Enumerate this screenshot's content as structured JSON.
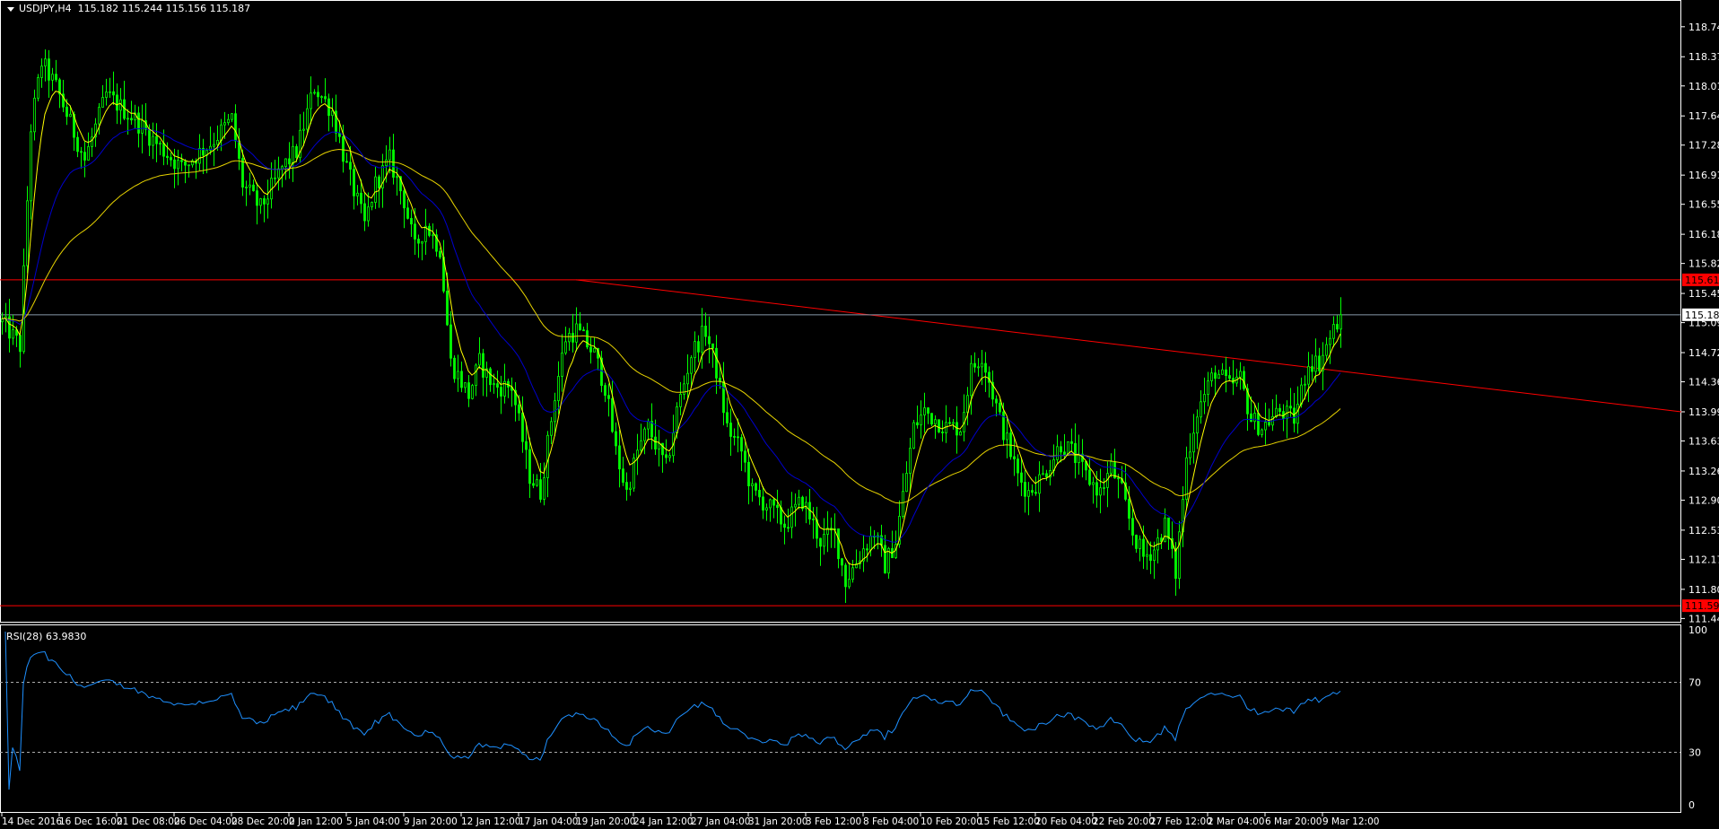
{
  "header": {
    "symbol": "USDJPY,H4",
    "ohlc": "115.182 115.244 115.156 115.187",
    "menu_icon": "triangle-down-icon"
  },
  "rsi_label": "RSI(28) 63.9830",
  "colors": {
    "bull": "#00ff00",
    "bear": "#00ff00",
    "fast_ma": "#ffff00",
    "mid_ma": "#0000cd",
    "slow_ma": "#e6d200",
    "level": "#ff0000",
    "rsi": "#1e90ff",
    "axis": "#ffffff"
  },
  "chart_data": {
    "type": "candlestick",
    "title": "USDJPY,H4",
    "price_ticks": [
      "118.740",
      "118.370",
      "118.010",
      "117.640",
      "117.280",
      "116.910",
      "116.550",
      "116.180",
      "115.820",
      "115.450",
      "115.090",
      "114.720",
      "114.360",
      "113.990",
      "113.630",
      "113.260",
      "112.900",
      "112.530",
      "112.170",
      "111.800",
      "111.440"
    ],
    "ylim": [
      111.4,
      119.07
    ],
    "current_price": "115.187",
    "levels": [
      {
        "value": "115.618"
      },
      {
        "value": "111.598"
      }
    ],
    "trendline": [
      [
        160,
        115.618
      ],
      [
        468,
        113.99
      ]
    ],
    "time_labels": [
      "14 Dec 2016",
      "16 Dec 16:00",
      "21 Dec 08:00",
      "26 Dec 04:00",
      "28 Dec 20:00",
      "2 Jan 12:00",
      "5 Jan 04:00",
      "9 Jan 20:00",
      "12 Jan 12:00",
      "17 Jan 04:00",
      "19 Jan 20:00",
      "24 Jan 12:00",
      "27 Jan 04:00",
      "31 Jan 20:00",
      "3 Feb 12:00",
      "8 Feb 04:00",
      "10 Feb 20:00",
      "15 Feb 12:00",
      "20 Feb 04:00",
      "22 Feb 20:00",
      "27 Feb 12:00",
      "2 Mar 04:00",
      "6 Mar 20:00",
      "9 Mar 12:00"
    ],
    "bars_per_label": 16,
    "price_path": [
      [
        0,
        115.1
      ],
      [
        5,
        114.8
      ],
      [
        8,
        117.5
      ],
      [
        11,
        118.3
      ],
      [
        15,
        118.0
      ],
      [
        23,
        117.1
      ],
      [
        29,
        117.9
      ],
      [
        37,
        117.6
      ],
      [
        43,
        117.3
      ],
      [
        50,
        117.0
      ],
      [
        58,
        117.3
      ],
      [
        64,
        117.6
      ],
      [
        67,
        116.8
      ],
      [
        72,
        116.5
      ],
      [
        78,
        117.0
      ],
      [
        82,
        117.2
      ],
      [
        87,
        118.0
      ],
      [
        92,
        117.7
      ],
      [
        96,
        117.0
      ],
      [
        101,
        116.3
      ],
      [
        104,
        116.8
      ],
      [
        108,
        117.1
      ],
      [
        112,
        116.6
      ],
      [
        115,
        116.0
      ],
      [
        118,
        116.3
      ],
      [
        122,
        116.0
      ],
      [
        125,
        114.6
      ],
      [
        130,
        114.2
      ],
      [
        133,
        114.6
      ],
      [
        137,
        114.3
      ],
      [
        142,
        114.3
      ],
      [
        147,
        113.2
      ],
      [
        150,
        113.0
      ],
      [
        154,
        114.2
      ],
      [
        157,
        114.9
      ],
      [
        160,
        115.0
      ],
      [
        165,
        114.7
      ],
      [
        168,
        114.3
      ],
      [
        171,
        113.5
      ],
      [
        174,
        113.0
      ],
      [
        177,
        113.5
      ],
      [
        180,
        113.8
      ],
      [
        185,
        113.3
      ],
      [
        188,
        114.0
      ],
      [
        192,
        114.7
      ],
      [
        196,
        115.0
      ],
      [
        199,
        114.5
      ],
      [
        202,
        113.8
      ],
      [
        206,
        113.5
      ],
      [
        209,
        113.0
      ],
      [
        214,
        112.8
      ],
      [
        218,
        112.6
      ],
      [
        223,
        112.9
      ],
      [
        228,
        112.4
      ],
      [
        232,
        112.5
      ],
      [
        235,
        111.9
      ],
      [
        240,
        112.3
      ],
      [
        243,
        112.5
      ],
      [
        246,
        112.1
      ],
      [
        249,
        112.4
      ],
      [
        254,
        113.8
      ],
      [
        257,
        114.0
      ],
      [
        263,
        113.8
      ],
      [
        267,
        113.8
      ],
      [
        270,
        114.5
      ],
      [
        273,
        114.7
      ],
      [
        278,
        113.9
      ],
      [
        283,
        113.2
      ],
      [
        286,
        113.0
      ],
      [
        290,
        113.2
      ],
      [
        295,
        113.6
      ],
      [
        298,
        113.5
      ],
      [
        302,
        113.2
      ],
      [
        306,
        113.0
      ],
      [
        309,
        113.3
      ],
      [
        312,
        113.0
      ],
      [
        315,
        112.5
      ],
      [
        318,
        112.2
      ],
      [
        321,
        112.3
      ],
      [
        324,
        112.6
      ],
      [
        327,
        112.0
      ],
      [
        330,
        113.4
      ],
      [
        333,
        114.0
      ],
      [
        338,
        114.5
      ],
      [
        342,
        114.3
      ],
      [
        345,
        114.4
      ],
      [
        348,
        113.9
      ],
      [
        351,
        113.8
      ],
      [
        356,
        114.0
      ],
      [
        360,
        113.9
      ],
      [
        364,
        114.6
      ],
      [
        367,
        114.6
      ],
      [
        370,
        114.9
      ],
      [
        373,
        115.187
      ]
    ],
    "indicators": [
      "MA fast (yellow)",
      "MA mid (blue)",
      "MA slow (yellow)"
    ],
    "rsi": {
      "period": 28,
      "value": 63.983,
      "ticks": [
        "100",
        "70",
        "30",
        "0"
      ],
      "levels": [
        70,
        30
      ],
      "ylim": [
        0,
        100
      ]
    }
  }
}
